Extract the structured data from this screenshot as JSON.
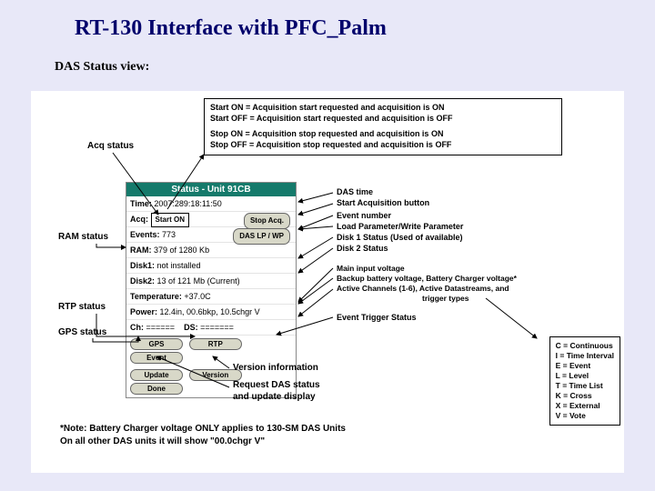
{
  "title": "RT-130 Interface with PFC_Palm",
  "subtitle": "DAS Status view:",
  "defs": {
    "l1": "Start ON  =  Acquisition start requested and acquisition is ON",
    "l2": "Start OFF =  Acquisition start requested and acquisition is OFF",
    "l3": "Stop ON  =  Acquisition stop requested and acquisition is ON",
    "l4": "Stop OFF =  Acquisition stop requested and acquisition is OFF"
  },
  "acq_label": "Acq status",
  "palm": {
    "title": "Status - Unit 91CB",
    "time_lbl": "Time:",
    "time_val": "2007:289:18:11:50",
    "acq_lbl": "Acq:",
    "start_on": "Start ON",
    "stop_btn": "Stop Acq.",
    "events_lbl": "Events:",
    "events_val": "773",
    "lpwp_btn": "DAS LP / WP",
    "ram_lbl": "RAM:",
    "ram_val": "379 of 1280 Kb",
    "disk1_lbl": "Disk1:",
    "disk1_val": "not installed",
    "disk2_lbl": "Disk2:",
    "disk2_val": "13 of 121 Mb (Current)",
    "temp_lbl": "Temperature:",
    "temp_val": "+37.0C",
    "power_lbl": "Power:",
    "power_val": "12.4in, 00.6bkp, 10.5chgr V",
    "ch_lbl": "Ch:",
    "ch_val": "======",
    "ds_lbl": "DS:",
    "ds_val": "=======",
    "btn_gps": "GPS",
    "btn_rtp": "RTP",
    "btn_event": "Event",
    "btn_update": "Update",
    "btn_version": "Version",
    "btn_done": "Done"
  },
  "left": {
    "ram": "RAM status",
    "rtp": "RTP status",
    "gps": "GPS status"
  },
  "right": {
    "das_time": "DAS time",
    "start_acq": "Start Acquisition button",
    "event_num": "Event number",
    "lpwp": "Load Parameter/Write Parameter",
    "disk1": "Disk 1 Status (Used of available)",
    "disk2": "Disk 2 Status",
    "main_v": "Main input voltage",
    "backup": "Backup battery voltage, Battery Charger voltage*",
    "active": "Active Channels (1-6), Active Datastreams, and",
    "active2": "trigger types",
    "ets": "Event Trigger Status"
  },
  "ver": {
    "l1": "Version information",
    "l2": "Request DAS status",
    "l3": "and update display"
  },
  "legend": {
    "c": "C = Continuous",
    "i": "I = Time Interval",
    "e": "E = Event",
    "l": "L = Level",
    "t": "T = Time List",
    "k": "K = Cross",
    "x": "X = External",
    "v": "V = Vote"
  },
  "note": {
    "l1": "*Note: Battery Charger voltage ONLY applies to 130-SM DAS Units",
    "l2": "On all other DAS units it will show \"00.0chgr V\""
  }
}
